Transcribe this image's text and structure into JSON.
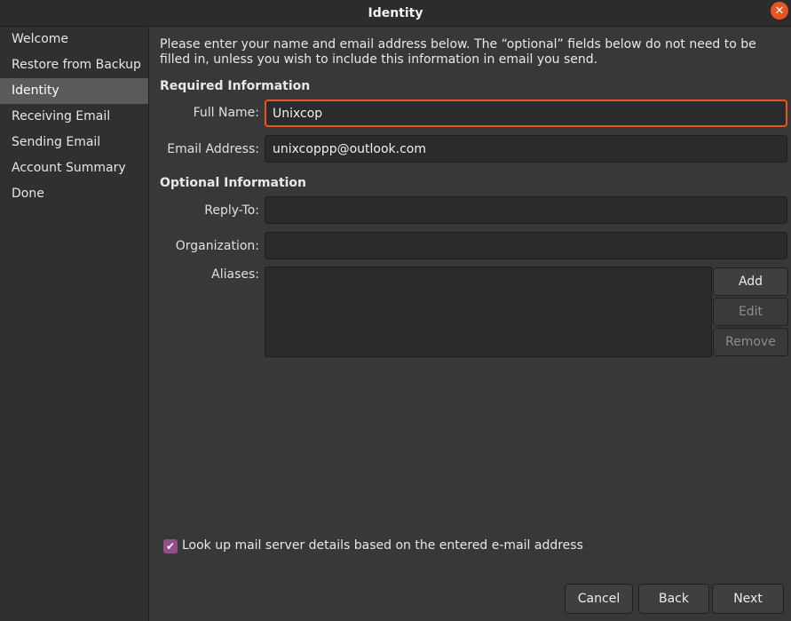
{
  "window": {
    "title": "Identity"
  },
  "sidebar": {
    "items": [
      {
        "label": "Welcome",
        "selected": false
      },
      {
        "label": "Restore from Backup",
        "selected": false
      },
      {
        "label": "Identity",
        "selected": true
      },
      {
        "label": "Receiving Email",
        "selected": false
      },
      {
        "label": "Sending Email",
        "selected": false
      },
      {
        "label": "Account Summary",
        "selected": false
      },
      {
        "label": "Done",
        "selected": false
      }
    ]
  },
  "intro": "Please enter your name and email address below. The “optional” fields below do not need to be filled in, unless you wish to include this information in email you send.",
  "required": {
    "heading": "Required Information",
    "full_name_label": "Full Name:",
    "full_name_value": "Unixcop",
    "email_label": "Email Address:",
    "email_value": "unixcoppp@outlook.com"
  },
  "optional": {
    "heading": "Optional Information",
    "reply_to_label": "Reply-To:",
    "reply_to_value": "",
    "organization_label": "Organization:",
    "organization_value": "",
    "aliases_label": "Aliases:"
  },
  "alias_buttons": {
    "add": "Add",
    "edit": "Edit",
    "remove": "Remove"
  },
  "lookup": {
    "checked": true,
    "label": "Look up mail server details based on the entered e-mail address"
  },
  "nav": {
    "cancel": "Cancel",
    "back": "Back",
    "next": "Next"
  },
  "colors": {
    "accent": "#e95420",
    "checkbox": "#924d8b"
  }
}
